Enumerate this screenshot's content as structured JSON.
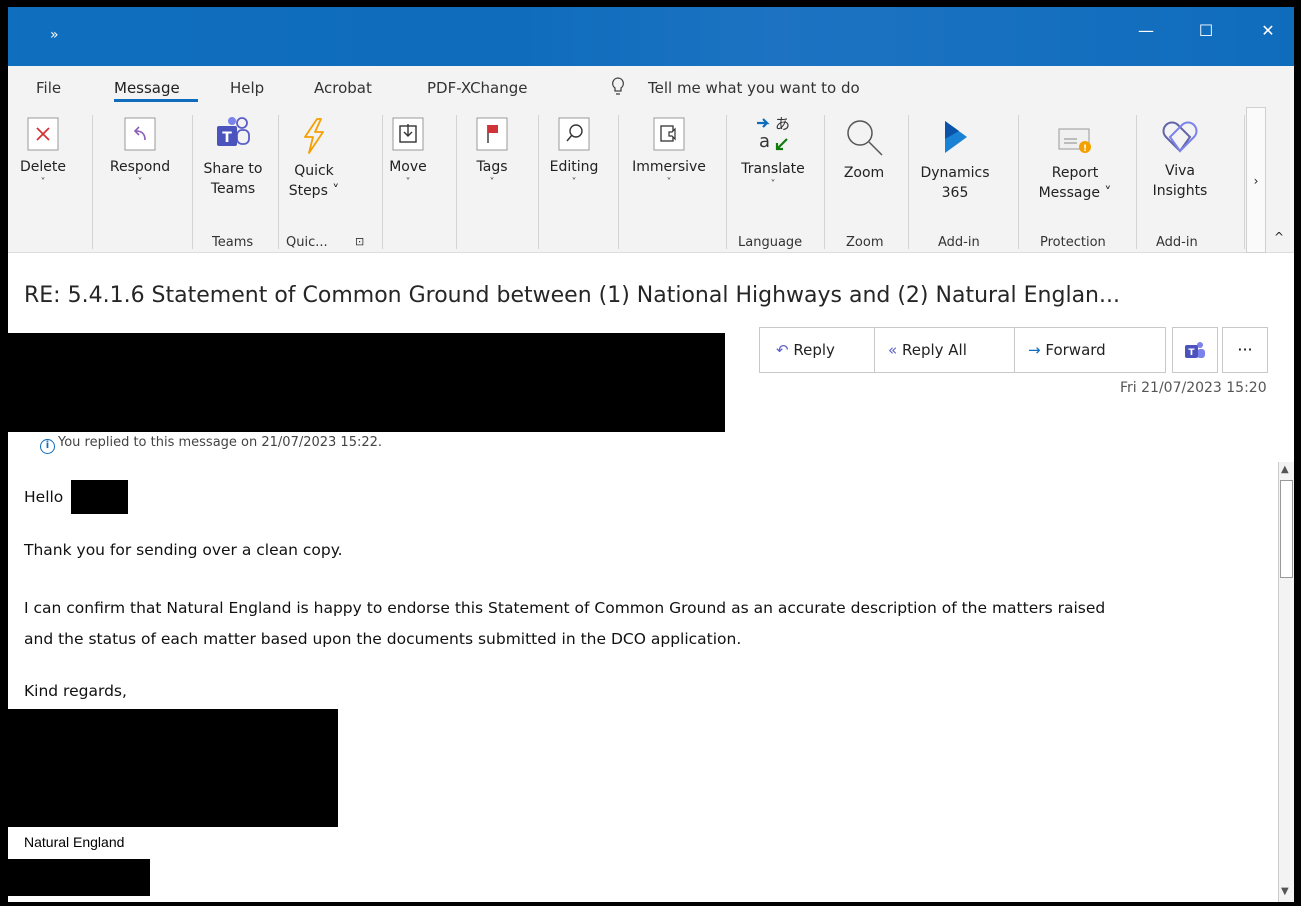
{
  "titlebar": {
    "quick_access": "»",
    "minimize": "—",
    "restore": "☐",
    "close": "✕"
  },
  "tabs": [
    "File",
    "Message",
    "Help",
    "Acrobat",
    "PDF-XChange"
  ],
  "tell_me": "Tell me what you want to do",
  "ribbon": {
    "delete": "Delete",
    "respond": "Respond",
    "share_teams_1": "Share to",
    "share_teams_2": "Teams",
    "quick_1": "Quick",
    "quick_2": "Steps ˅",
    "move": "Move",
    "tags": "Tags",
    "editing": "Editing",
    "immersive": "Immersive",
    "translate": "Translate",
    "zoom": "Zoom",
    "dynamics_1": "Dynamics",
    "dynamics_2": "365",
    "report_1": "Report",
    "report_2": "Message ˅",
    "viva_1": "Viva",
    "viva_2": "Insights",
    "more": "›",
    "collapse": "^",
    "groups": {
      "teams": "Teams",
      "quick": "Quic...",
      "language": "Language",
      "zoom": "Zoom",
      "addin1": "Add-in",
      "protection": "Protection",
      "addin2": "Add-in"
    }
  },
  "email": {
    "subject": "RE: 5.4.1.6 Statement of Common Ground between (1) National Highways and (2) Natural Englan...",
    "reply": "Reply",
    "reply_all": "Reply All",
    "forward": "Forward",
    "more": "···",
    "date": "Fri 21/07/2023 15:20",
    "info": "You replied to this message on 21/07/2023 15:22.",
    "greeting": "Hello",
    "line1": "Thank you for sending over a clean copy.",
    "line2a": "I can confirm that Natural England is happy to endorse this Statement of Common Ground as an accurate description of the matters raised",
    "line2b": "and the status of each matter based upon the documents submitted in the DCO application.",
    "closing": "Kind regards,",
    "org": "Natural England"
  }
}
